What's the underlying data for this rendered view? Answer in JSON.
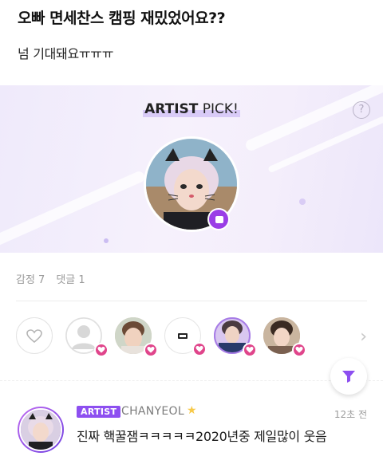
{
  "post": {
    "title": "오빠 면세찬스 캠핑 재밌었어요??",
    "body": "넘 기대돼요ㅠㅠㅠ"
  },
  "artist_pick": {
    "label_bold": "ARTIST",
    "label_rest": " PICK!",
    "help_icon": "?"
  },
  "stats": {
    "emotions": "감정 7",
    "comments": "댓글 1"
  },
  "reactions": {
    "count_shown": 6,
    "more_icon": "›"
  },
  "comment": {
    "badge": "ARTIST",
    "author": "CHANYEOL",
    "star": "★",
    "time": "12초 전",
    "text": "진짜 핵꿀잼ㅋㅋㅋㅋㅋ2020년중 제일많이 웃음"
  },
  "colors": {
    "brand_purple": "#8d4ff0",
    "heart_pink": "#e0458b",
    "banner_bg": "#f3eefb"
  }
}
